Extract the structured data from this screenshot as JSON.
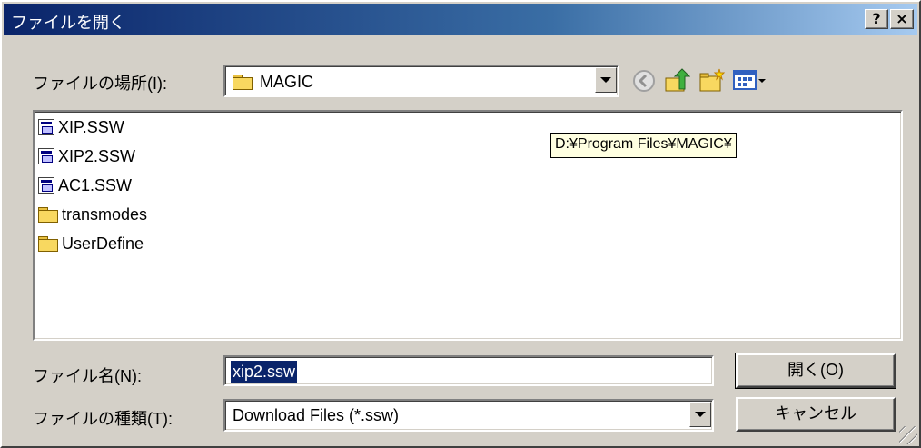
{
  "dialog": {
    "title": "ファイルを開く",
    "help_button": "?",
    "close_button": "×"
  },
  "lookin": {
    "label": "ファイルの場所(I):",
    "value": "MAGIC"
  },
  "toolbar": {
    "back_icon": "back-arrow-icon",
    "up_icon": "up-folder-icon",
    "new_folder_icon": "new-folder-icon",
    "view_menu_icon": "view-menu-icon"
  },
  "files": [
    {
      "name": "XIP.SSW",
      "type": "file"
    },
    {
      "name": "XIP2.SSW",
      "type": "file"
    },
    {
      "name": "AC1.SSW",
      "type": "file"
    },
    {
      "name": "transmodes",
      "type": "folder"
    },
    {
      "name": "UserDefine",
      "type": "folder"
    }
  ],
  "tooltip": "D:¥Program Files¥MAGIC¥",
  "filename": {
    "label": "ファイル名(N):",
    "value": "xip2.ssw"
  },
  "filetype": {
    "label": "ファイルの種類(T):",
    "value": "Download Files (*.ssw)"
  },
  "buttons": {
    "open": "開く(O)",
    "cancel": "キャンセル"
  },
  "colors": {
    "title_start": "#0a246a",
    "title_end": "#a6caf0",
    "face": "#d4d0c8",
    "selection": "#0a246a",
    "tooltip_bg": "#ffffe1"
  }
}
